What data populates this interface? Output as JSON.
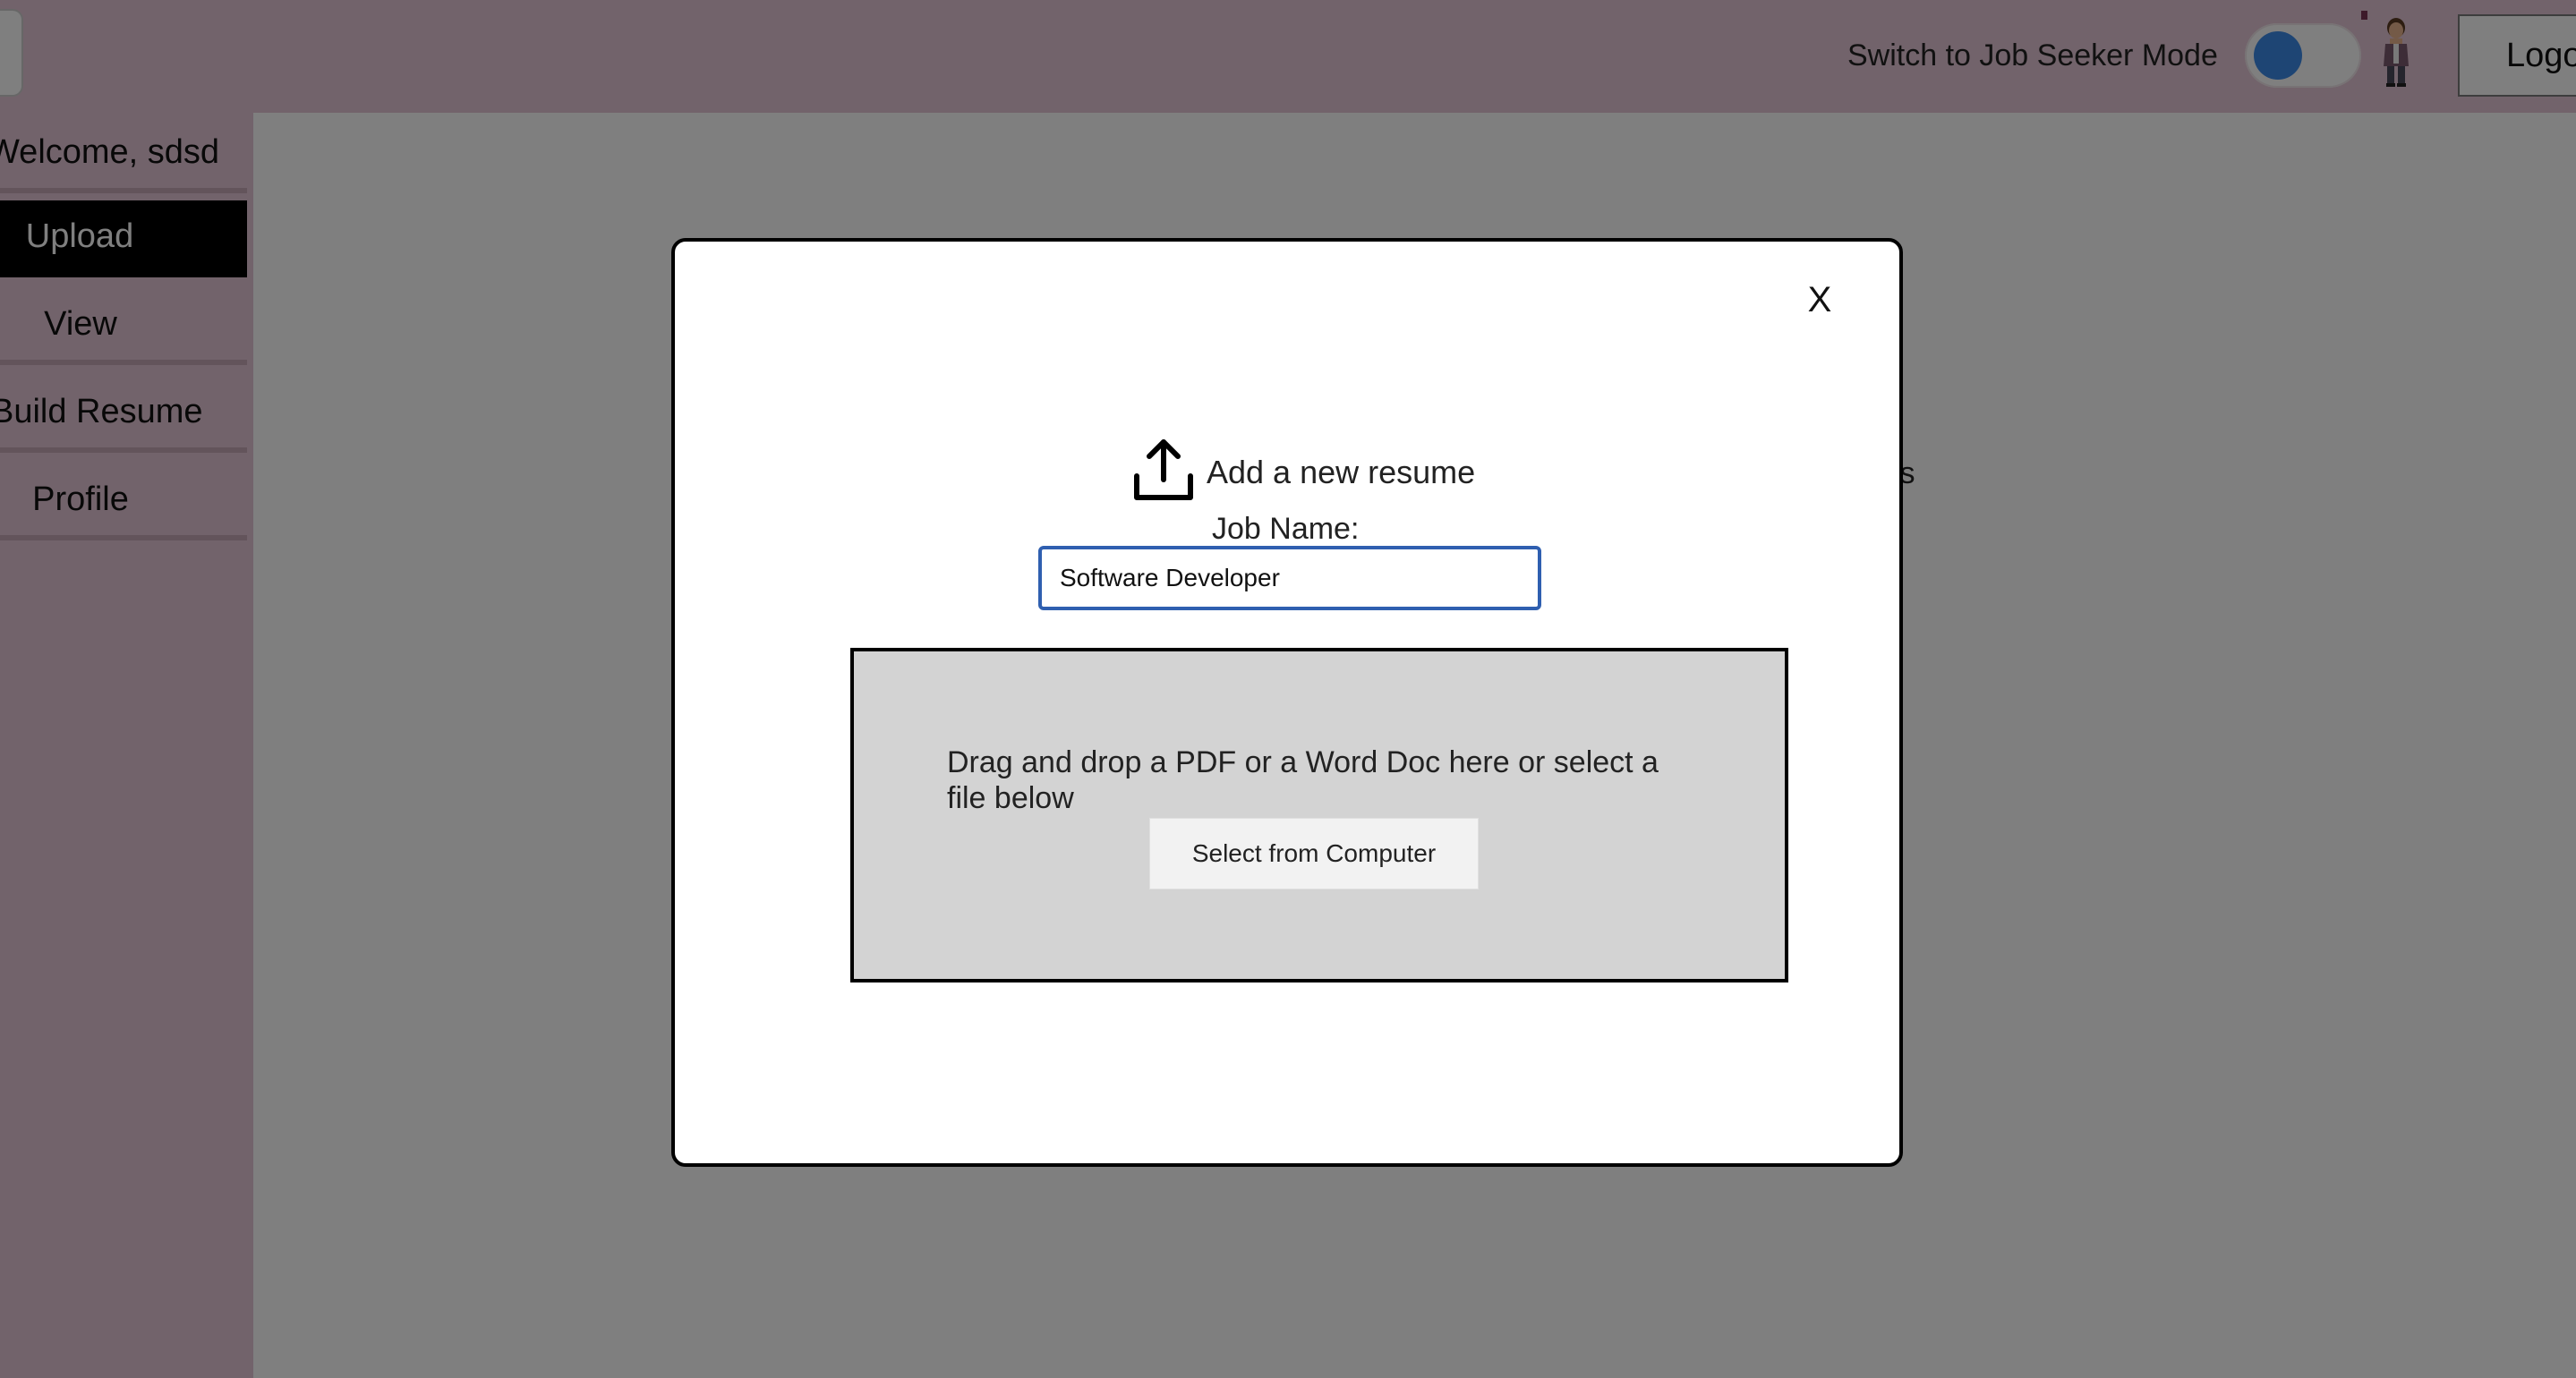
{
  "header": {
    "mode_toggle_label": "Switch to Job Seeker Mode",
    "logout_label": "Logout",
    "toggle_color": "#3d8be8",
    "bar_color": "#e5c7d6"
  },
  "sidebar": {
    "welcome": "Welcome, sdsd",
    "items": [
      {
        "label": "Upload",
        "active": true
      },
      {
        "label": "View"
      },
      {
        "label": "Build Resume"
      },
      {
        "label": "Profile"
      }
    ]
  },
  "main": {
    "background_text": "ies"
  },
  "modal": {
    "close_label": "X",
    "title": "Add a new resume",
    "icon": "upload-icon",
    "job_name_label": "Job Name:",
    "job_name_value": "Software Developer",
    "dropzone_text": "Drag and drop a PDF or a Word Doc here or select a file below",
    "select_button_label": "Select from Computer"
  }
}
